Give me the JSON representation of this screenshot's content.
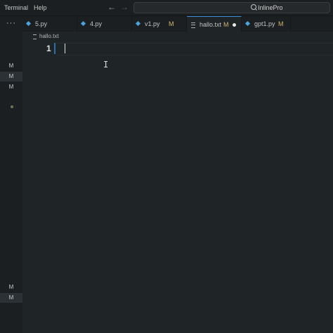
{
  "menu": {
    "terminal": "Terminal",
    "help": "Help"
  },
  "nav": {
    "back": "←",
    "forward": "→"
  },
  "search": {
    "text": "InlinePro"
  },
  "activity": {
    "more": "···",
    "marks": [
      "M",
      "M",
      "M",
      "M",
      "M"
    ]
  },
  "tabs": [
    {
      "label": "5.py",
      "modified": "",
      "icon": "python-file-icon"
    },
    {
      "label": "4.py",
      "modified": "",
      "icon": "python-file-icon"
    },
    {
      "label": "v1.py",
      "modified": "M",
      "icon": "python-file-icon"
    },
    {
      "label": "hallo.txt",
      "modified": "M",
      "icon": "text-file-icon",
      "active": true
    },
    {
      "label": "gpt1.py",
      "modified": "M",
      "icon": "python-file-icon"
    }
  ],
  "breadcrumb": {
    "file": "hallo.txt"
  },
  "editor": {
    "line_number": "1"
  },
  "colors": {
    "accent": "#3b8fd6",
    "modified": "#d3b56a",
    "background": "#1f2427"
  }
}
